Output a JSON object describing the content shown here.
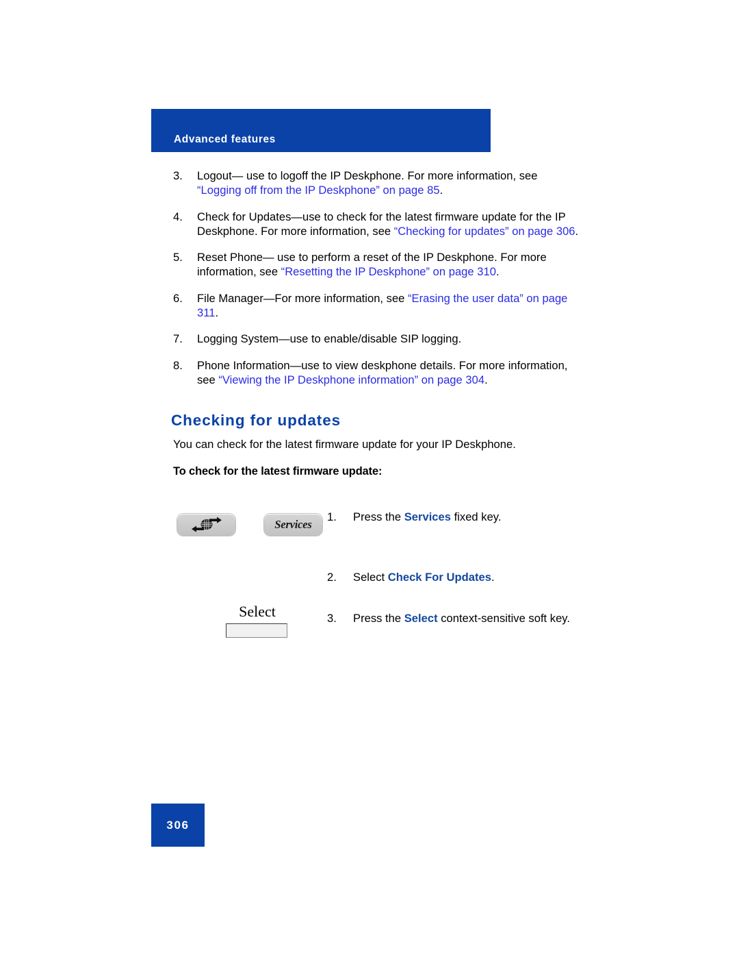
{
  "header": {
    "title": "Advanced features"
  },
  "list": {
    "items": [
      {
        "number": "3.",
        "parts": [
          {
            "text": "Logout— use to logoff the IP Deskphone. For more information, see ",
            "style": "plain"
          },
          {
            "text": "“Logging off from the IP Deskphone” on page 85",
            "style": "xref"
          },
          {
            "text": ".",
            "style": "plain"
          }
        ]
      },
      {
        "number": "4.",
        "parts": [
          {
            "text": "Check for Updates—use to check for the latest firmware update for the IP Deskphone. For more information, see ",
            "style": "plain"
          },
          {
            "text": "“Checking for updates” on page 306",
            "style": "xref"
          },
          {
            "text": ".",
            "style": "plain"
          }
        ]
      },
      {
        "number": "5.",
        "parts": [
          {
            "text": "Reset Phone— use to perform a reset of the IP Deskphone. For more information, see ",
            "style": "plain"
          },
          {
            "text": "“Resetting the IP Deskphone” on page 310",
            "style": "xref"
          },
          {
            "text": ".",
            "style": "plain"
          }
        ]
      },
      {
        "number": "6.",
        "parts": [
          {
            "text": "File Manager—For more information, see ",
            "style": "plain"
          },
          {
            "text": "“Erasing the user data” on page 311",
            "style": "xref"
          },
          {
            "text": ".",
            "style": "plain"
          }
        ]
      },
      {
        "number": "7.",
        "parts": [
          {
            "text": "Logging System—use to enable/disable SIP logging.",
            "style": "plain"
          }
        ]
      },
      {
        "number": "8.",
        "parts": [
          {
            "text": "Phone Information—use to view deskphone details. For more information, see ",
            "style": "plain"
          },
          {
            "text": "“Viewing the IP Deskphone information” on page 304",
            "style": "xref"
          },
          {
            "text": ".",
            "style": "plain"
          }
        ]
      }
    ]
  },
  "section": {
    "heading": "Checking for updates",
    "intro": "You can check for the latest firmware update for your IP Deskphone.",
    "procedure_title": "To check for the latest firmware update:"
  },
  "steps": [
    {
      "number": "1.",
      "before": "Press the ",
      "emphasis": "Services",
      "after": " fixed key."
    },
    {
      "number": "2.",
      "before": "Select ",
      "emphasis": "Check For Updates",
      "after": "."
    },
    {
      "number": "3.",
      "before": "Press the ",
      "emphasis": "Select",
      "after": " context-sensitive soft key."
    }
  ],
  "keys": {
    "services_icon_name": "services-globe-key",
    "services_label": "Services",
    "softkey_label": "Select"
  },
  "footer": {
    "page_number": "306"
  },
  "colors": {
    "brand_blue": "#0a42a8",
    "xref_blue": "#2b2be6",
    "emphasis_blue": "#15489f",
    "key_gray": "#cdcdcd"
  }
}
